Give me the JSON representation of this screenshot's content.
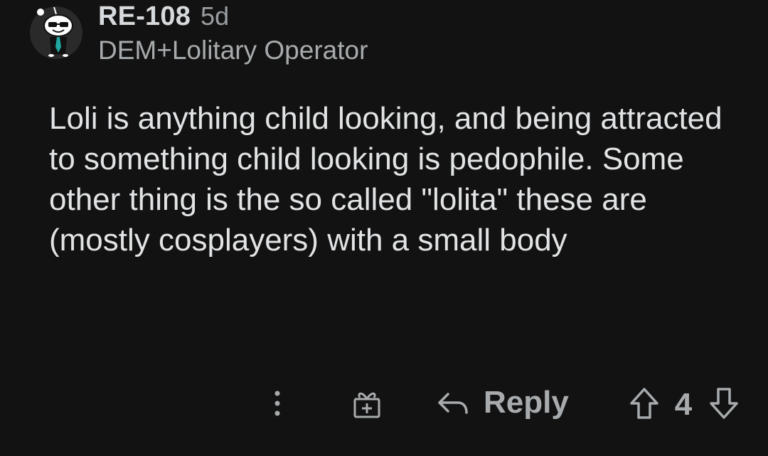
{
  "comment": {
    "username": "RE-108",
    "age": "5d",
    "flair": "DEM+Lolitary Operator",
    "body": "Loli is anything child looking, and being attracted to something child looking is pedophile. Some other thing is the so called \"lolita\" these are (mostly cosplayers) with a small body"
  },
  "actions": {
    "more_icon": "more-vertical-icon",
    "award_icon": "award-gift-icon",
    "reply_icon": "reply-arrow-icon",
    "reply_label": "Reply",
    "upvote_icon": "upvote-arrow-icon",
    "score": "4",
    "downvote_icon": "downvote-arrow-icon"
  },
  "colors": {
    "background": "#121212",
    "text_primary": "#e1e3e5",
    "text_secondary": "#a8abad",
    "avatar_accent": "#1fa7a0"
  }
}
